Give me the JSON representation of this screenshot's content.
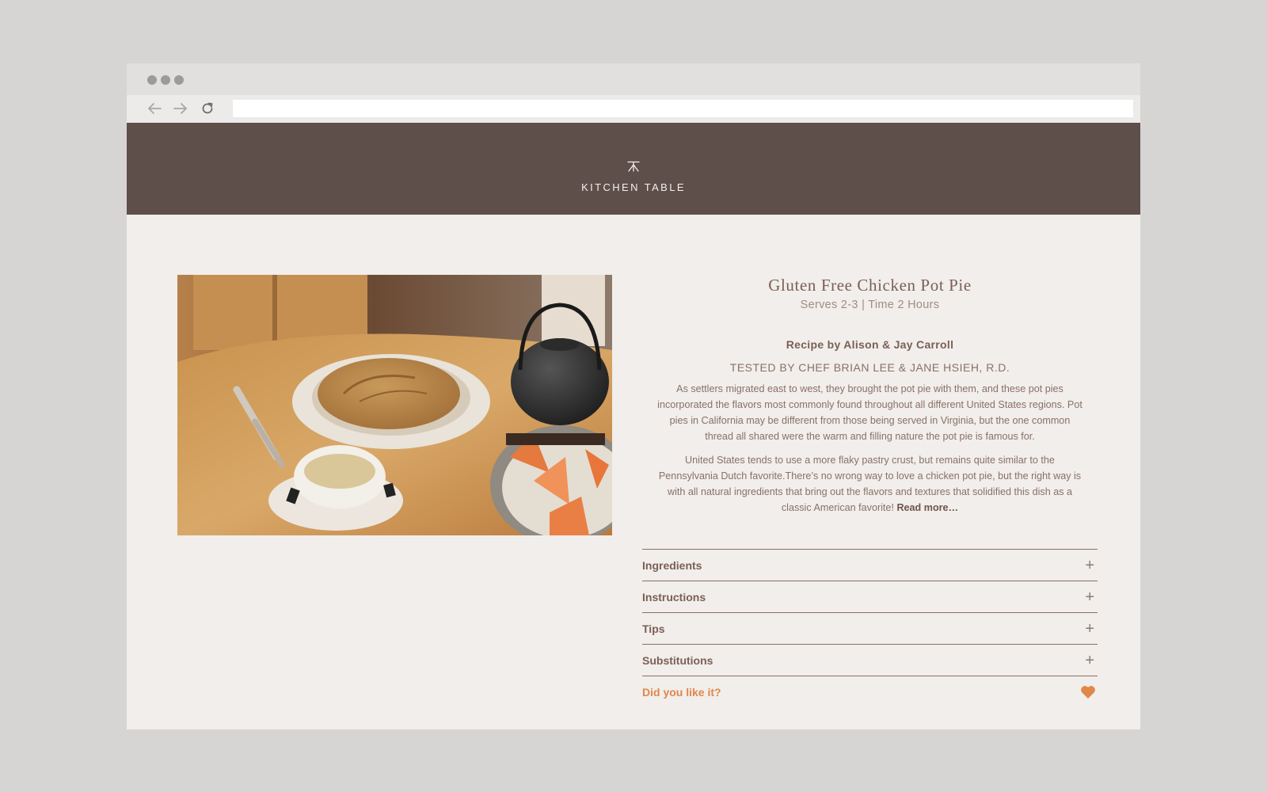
{
  "browser": {
    "url": ""
  },
  "site": {
    "name": "KITCHEN TABLE"
  },
  "recipe": {
    "title": "Gluten Free Chicken Pot Pie",
    "meta": "Serves 2-3 | Time 2 Hours",
    "author": "Recipe by Alison & Jay Carroll",
    "tested_by": "TESTED BY CHEF BRIAN LEE & JANE HSIEH, R.D.",
    "paragraph_1": "As settlers migrated east to west, they brought the pot pie with them, and these pot pies incorporated the flavors most commonly found throughout all different United States regions. Pot pies in California may be different from those being served in Virginia, but the one common thread all shared were the warm and filling nature the pot pie is famous for.",
    "paragraph_2": "United States tends to use a more flaky pastry crust, but remains quite similar to the Pennsylvania Dutch favorite.There’s no wrong way to love a chicken pot pie, but the right way is with all natural ingredients that bring out the flavors and textures that solidified this dish as a classic American favorite!",
    "read_more": "Read more…"
  },
  "accordion": [
    {
      "label": "Ingredients",
      "icon": "+"
    },
    {
      "label": "Instructions",
      "icon": "+"
    },
    {
      "label": "Tips",
      "icon": "+"
    },
    {
      "label": "Substitutions",
      "icon": "+"
    }
  ],
  "feedback": {
    "label": "Did you like it?",
    "icon": "heart-icon",
    "color": "#e0874b"
  },
  "colors": {
    "header_bg": "#5e4f4b",
    "page_bg": "#f1eeeb",
    "text_brown": "#7b5f55",
    "accent": "#e0874b"
  }
}
